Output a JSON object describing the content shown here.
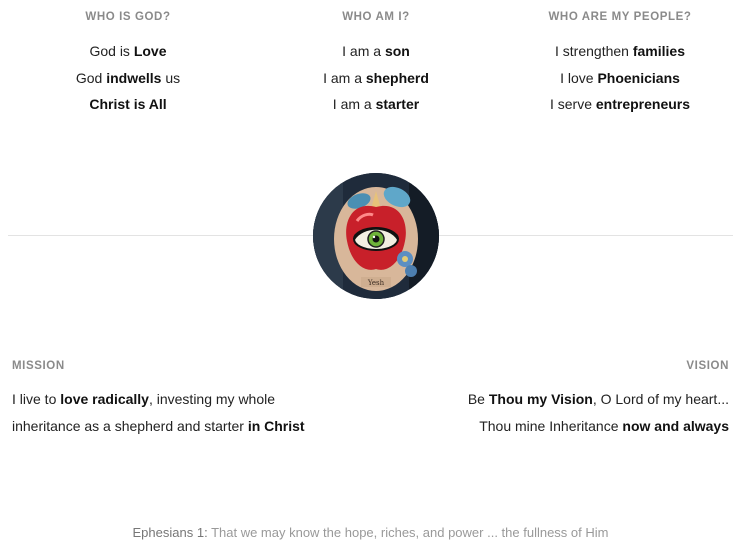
{
  "columns": [
    {
      "heading": "WHO IS GOD?",
      "lines": [
        {
          "pre": "God is ",
          "bold": "Love",
          "post": ""
        },
        {
          "pre": "God ",
          "bold": "indwells",
          "post": " us"
        },
        {
          "pre": "",
          "bold": "Christ is All",
          "post": ""
        }
      ]
    },
    {
      "heading": "WHO AM I?",
      "lines": [
        {
          "pre": "I am a ",
          "bold": "son",
          "post": ""
        },
        {
          "pre": "I am a ",
          "bold": "shepherd",
          "post": ""
        },
        {
          "pre": "I am a ",
          "bold": "starter",
          "post": ""
        }
      ]
    },
    {
      "heading": "WHO ARE MY PEOPLE?",
      "lines": [
        {
          "pre": "I strengthen ",
          "bold": "families",
          "post": ""
        },
        {
          "pre": "I love ",
          "bold": "Phoenicians",
          "post": ""
        },
        {
          "pre": "I serve ",
          "bold": "entrepreneurs",
          "post": ""
        }
      ]
    }
  ],
  "mission": {
    "heading": "MISSION",
    "line1": {
      "pre": "I live to ",
      "bold": "love radically",
      "post": ", investing my whole"
    },
    "line2": {
      "pre": "inheritance as a shepherd and starter ",
      "bold": "in Christ",
      "post": ""
    }
  },
  "vision": {
    "heading": "VISION",
    "line1": {
      "pre": "Be ",
      "bold": "Thou my Vision",
      "post": ", O Lord of my heart..."
    },
    "line2": {
      "pre": "Thou mine Inheritance ",
      "bold": "now and always",
      "post": ""
    }
  },
  "verse": {
    "reference": "Ephesians 1:",
    "text": " That we may know the hope, riches, and power ... the fullness of Him"
  },
  "avatar": {
    "icon": "apple-eye-tattoo-image",
    "caption": "Yesh"
  },
  "colors": {
    "heading": "#8a8a8a",
    "text": "#222222",
    "divider": "#e3e3e3",
    "verse": "#999999"
  }
}
